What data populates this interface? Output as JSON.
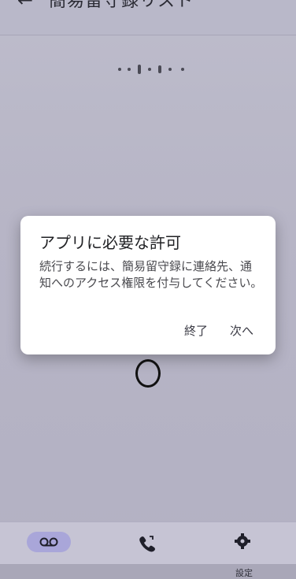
{
  "app": {
    "back_icon": "arrow-left-icon",
    "title": "簡易留守録リスト"
  },
  "dialog": {
    "title": "アプリに必要な許可",
    "body": "続行するには、簡易留守録に連絡先、通知へのアクセス権限を付与してください。",
    "cancel_label": "終了",
    "next_label": "次へ"
  },
  "bottom_nav": {
    "items": [
      {
        "icon": "voicemail-icon",
        "label": "",
        "active": true
      },
      {
        "icon": "phone-icon",
        "label": ""
      },
      {
        "icon": "settings-icon",
        "label": "設定"
      }
    ]
  },
  "colors": {
    "scrim": "#b7b5c6",
    "active_pill": "#a9a6d9",
    "dialog_bg": "#ffffff"
  }
}
